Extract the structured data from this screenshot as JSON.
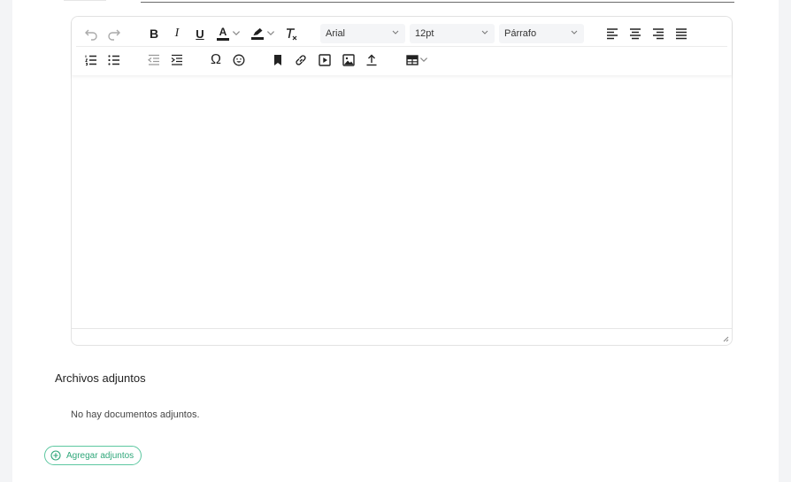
{
  "editor": {
    "font_family": "Arial",
    "font_size": "12pt",
    "block_format": "Párrafo",
    "toolbar_row1": [
      "undo-icon",
      "redo-icon",
      "bold-icon",
      "italic-icon",
      "underline-icon",
      "text-color-icon",
      "highlight-icon",
      "clear-format-icon",
      "align-left-icon",
      "align-center-icon",
      "align-right-icon",
      "align-justify-icon"
    ],
    "toolbar_row2": [
      "numbered-list-icon",
      "bullet-list-icon",
      "outdent-icon",
      "indent-icon",
      "special-char-icon",
      "emoji-icon",
      "bookmark-icon",
      "link-icon",
      "media-icon",
      "image-icon",
      "upload-icon",
      "table-icon"
    ],
    "bold_glyph": "B",
    "italic_glyph": "I",
    "underline_glyph": "U",
    "text_color_glyph": "A",
    "omega_glyph": "Ω"
  },
  "attachments": {
    "title": "Archivos adjuntos",
    "empty_message": "No hay documentos adjuntos.",
    "add_label": "Agregar adjuntos"
  },
  "colors": {
    "accent": "#2fa77a",
    "accent_border": "#5cc7a0",
    "text_color_bar": "#1f1f1f"
  }
}
